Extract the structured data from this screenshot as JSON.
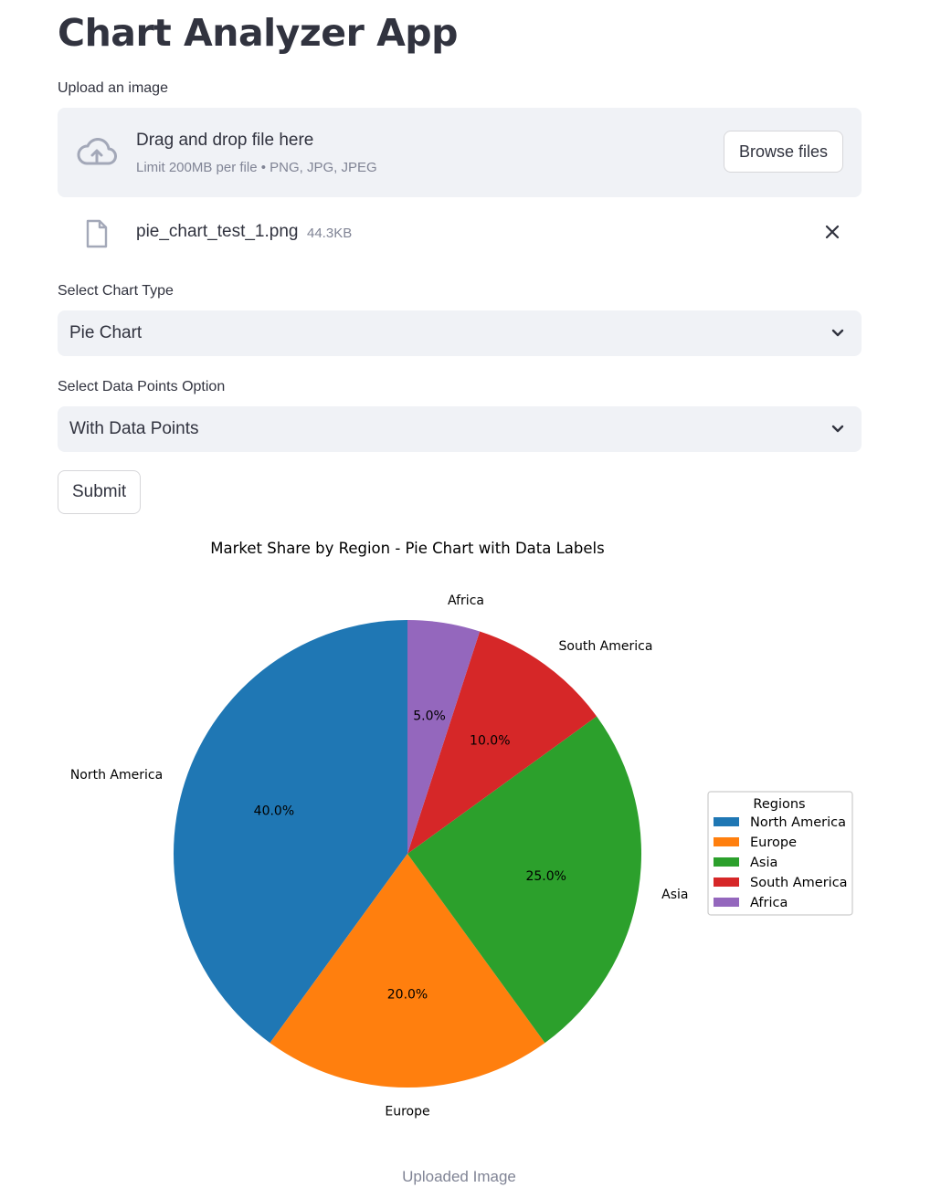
{
  "app": {
    "title": "Chart Analyzer App"
  },
  "uploader": {
    "label": "Upload an image",
    "drop_title": "Drag and drop file here",
    "drop_limit": "Limit 200MB per file • PNG, JPG, JPEG",
    "browse_label": "Browse files",
    "file": {
      "name": "pie_chart_test_1.png",
      "size": "44.3KB"
    }
  },
  "chart_type_select": {
    "label": "Select Chart Type",
    "value": "Pie Chart"
  },
  "data_points_select": {
    "label": "Select Data Points Option",
    "value": "With Data Points"
  },
  "submit_label": "Submit",
  "image_caption": "Uploaded Image",
  "icons": {
    "upload": "cloud-upload-icon",
    "file": "file-icon",
    "remove": "close-icon",
    "dropdown": "chevron-down-icon"
  },
  "colors": {
    "accent_bg": "#f0f2f6",
    "text": "#31333f",
    "muted": "#808495"
  },
  "chart_data": {
    "type": "pie",
    "title": "Market Share by Region - Pie Chart with Data Labels",
    "categories": [
      "North America",
      "Europe",
      "Asia",
      "South America",
      "Africa"
    ],
    "values": [
      40.0,
      20.0,
      25.0,
      10.0,
      5.0
    ],
    "value_labels": [
      "40.0%",
      "20.0%",
      "25.0%",
      "10.0%",
      "5.0%"
    ],
    "colors": [
      "#1f77b4",
      "#ff7f0e",
      "#2ca02c",
      "#d62728",
      "#9467bd"
    ],
    "start_angle_deg": 90,
    "direction": "counterclockwise",
    "legend": {
      "title": "Regions",
      "entries": [
        "North America",
        "Europe",
        "Asia",
        "South America",
        "Africa"
      ],
      "placement": "right"
    }
  }
}
